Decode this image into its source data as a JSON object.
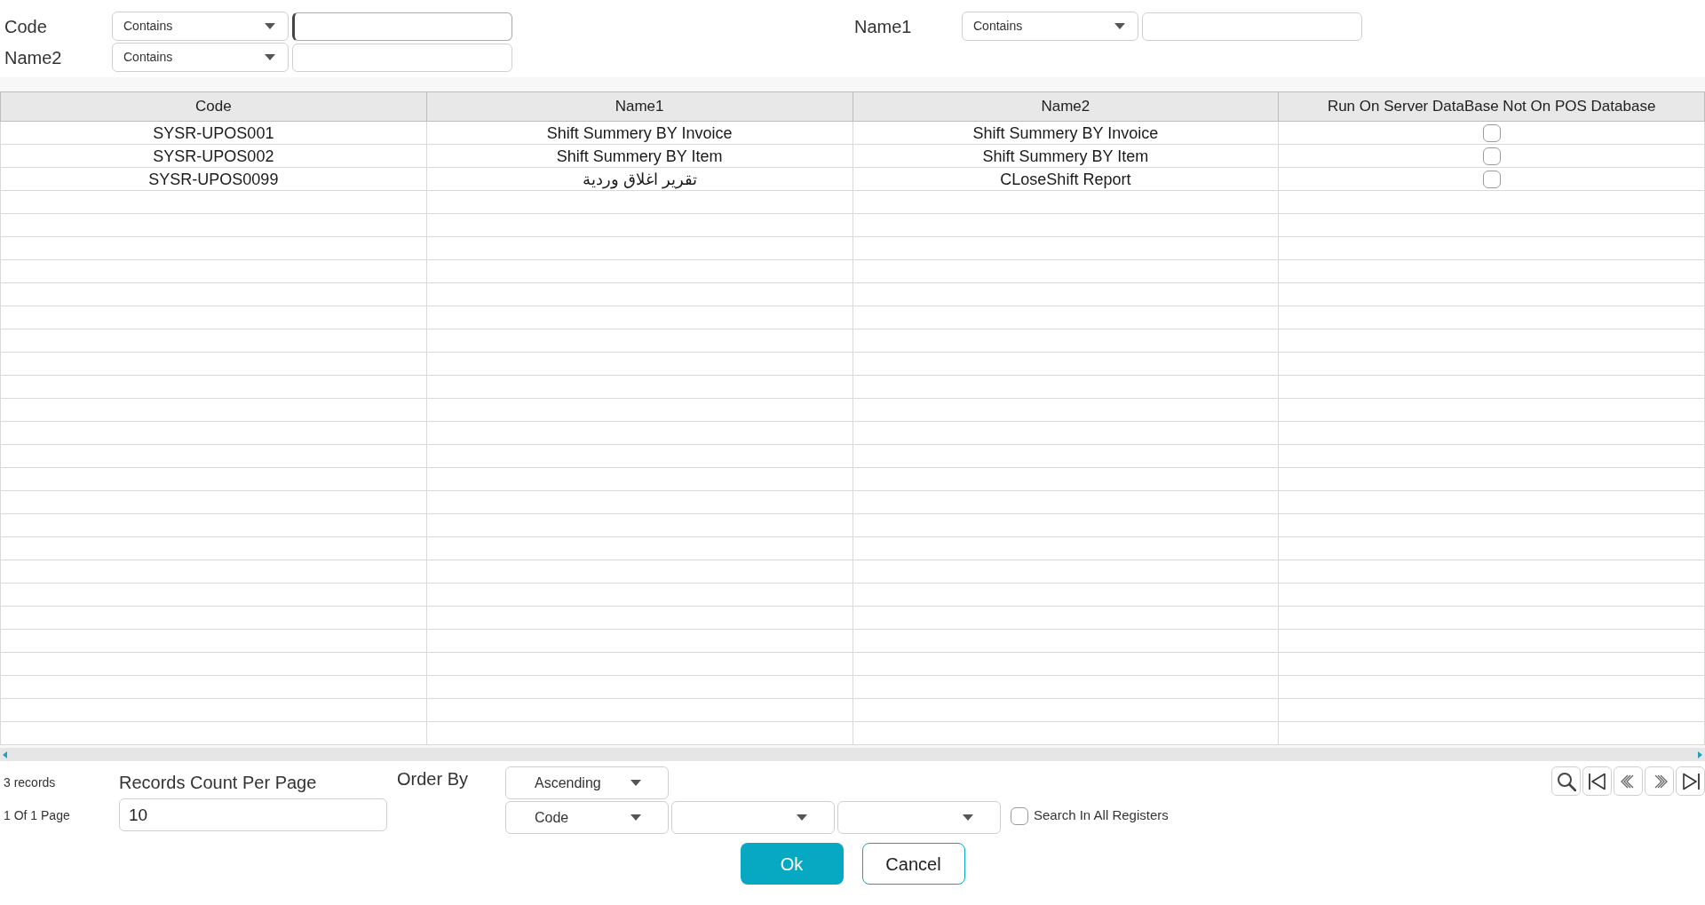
{
  "filters": [
    {
      "label": "Code",
      "operator": "Contains",
      "focused": true
    },
    {
      "label": "Name1",
      "operator": "Contains",
      "focused": false
    },
    {
      "label": "Name2",
      "operator": "Contains",
      "focused": false
    }
  ],
  "table": {
    "columns": [
      "Code",
      "Name1",
      "Name2",
      "Run On Server DataBase Not On POS Database"
    ],
    "rows": [
      {
        "cells": [
          "SYSR-UPOS001",
          "Shift Summery BY Invoice",
          "Shift Summery BY Invoice"
        ],
        "run_on_server": false
      },
      {
        "cells": [
          "SYSR-UPOS002",
          "Shift Summery BY Item",
          "Shift Summery BY Item"
        ],
        "run_on_server": false
      },
      {
        "cells": [
          "SYSR-UPOS0099",
          "تقرير اغلاق وردية",
          "CLoseShift Report"
        ],
        "run_on_server": false
      }
    ]
  },
  "footer": {
    "record_count": "3 records",
    "page_info": "1 Of 1 Page",
    "records_per_page": {
      "label": "Records Count Per Page",
      "value": "10"
    },
    "order_by": {
      "label": "Order By",
      "direction": "Ascending",
      "fields": [
        "Code"
      ]
    },
    "search_all_registers": {
      "label": "Search In All Registers",
      "checked": false
    }
  },
  "buttons": [
    {
      "label": "Ok",
      "kind": "primary"
    },
    {
      "label": "Cancel",
      "kind": "secondary"
    }
  ]
}
